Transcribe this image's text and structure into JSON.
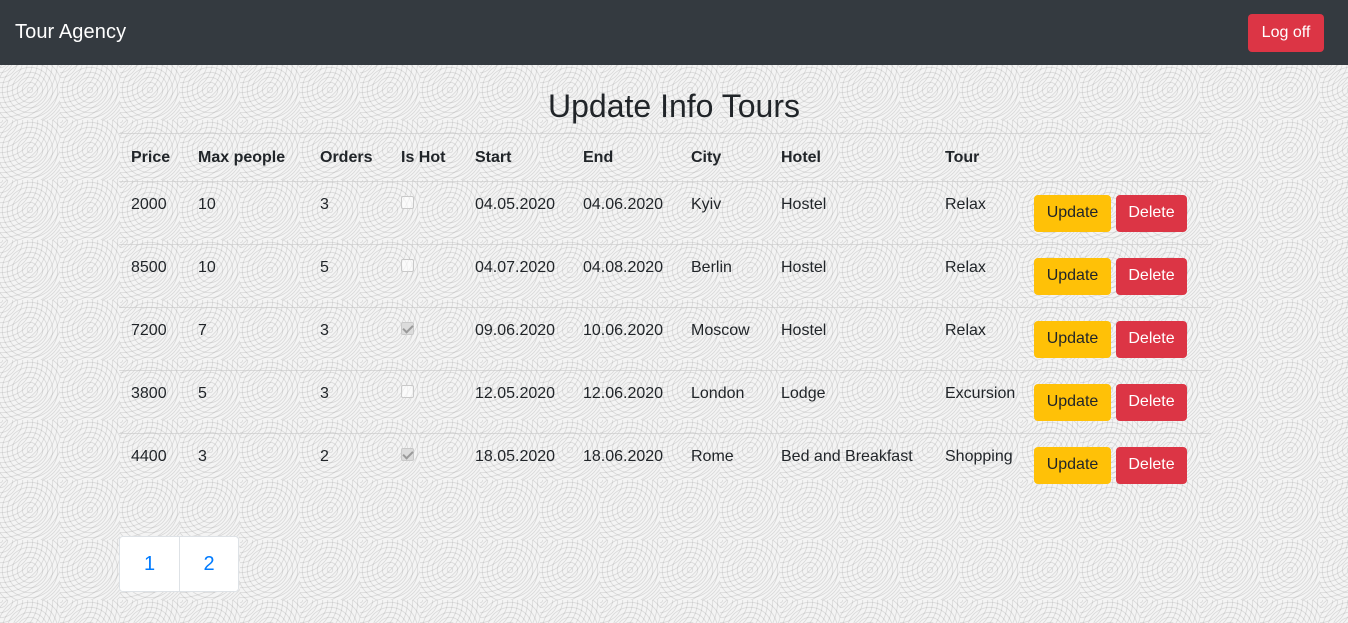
{
  "navbar": {
    "brand": "Tour Agency",
    "logoff_label": "Log off",
    "colors": {
      "background": "#343a40",
      "logoff": "#dc3545"
    }
  },
  "page": {
    "title": "Update Info Tours"
  },
  "table": {
    "headers": [
      "Price",
      "Max people",
      "Orders",
      "Is Hot",
      "Start",
      "End",
      "City",
      "Hotel",
      "Tour"
    ],
    "rows": [
      {
        "price": "2000",
        "max_people": "10",
        "orders": "3",
        "is_hot": false,
        "start": "04.05.2020",
        "end": "04.06.2020",
        "city": "Kyiv",
        "hotel": "Hostel",
        "tour": "Relax"
      },
      {
        "price": "8500",
        "max_people": "10",
        "orders": "5",
        "is_hot": false,
        "start": "04.07.2020",
        "end": "04.08.2020",
        "city": "Berlin",
        "hotel": "Hostel",
        "tour": "Relax"
      },
      {
        "price": "7200",
        "max_people": "7",
        "orders": "3",
        "is_hot": true,
        "start": "09.06.2020",
        "end": "10.06.2020",
        "city": "Moscow",
        "hotel": "Hostel",
        "tour": "Relax"
      },
      {
        "price": "3800",
        "max_people": "5",
        "orders": "3",
        "is_hot": false,
        "start": "12.05.2020",
        "end": "12.06.2020",
        "city": "London",
        "hotel": "Lodge",
        "tour": "Excursion"
      },
      {
        "price": "4400",
        "max_people": "3",
        "orders": "2",
        "is_hot": true,
        "start": "18.05.2020",
        "end": "18.06.2020",
        "city": "Rome",
        "hotel": "Bed and Breakfast",
        "tour": "Shopping"
      }
    ],
    "update_label": "Update",
    "delete_label": "Delete",
    "colors": {
      "update": "#ffc107",
      "delete": "#dc3545"
    }
  },
  "pagination": {
    "pages": [
      "1",
      "2"
    ],
    "link_color": "#007bff"
  }
}
